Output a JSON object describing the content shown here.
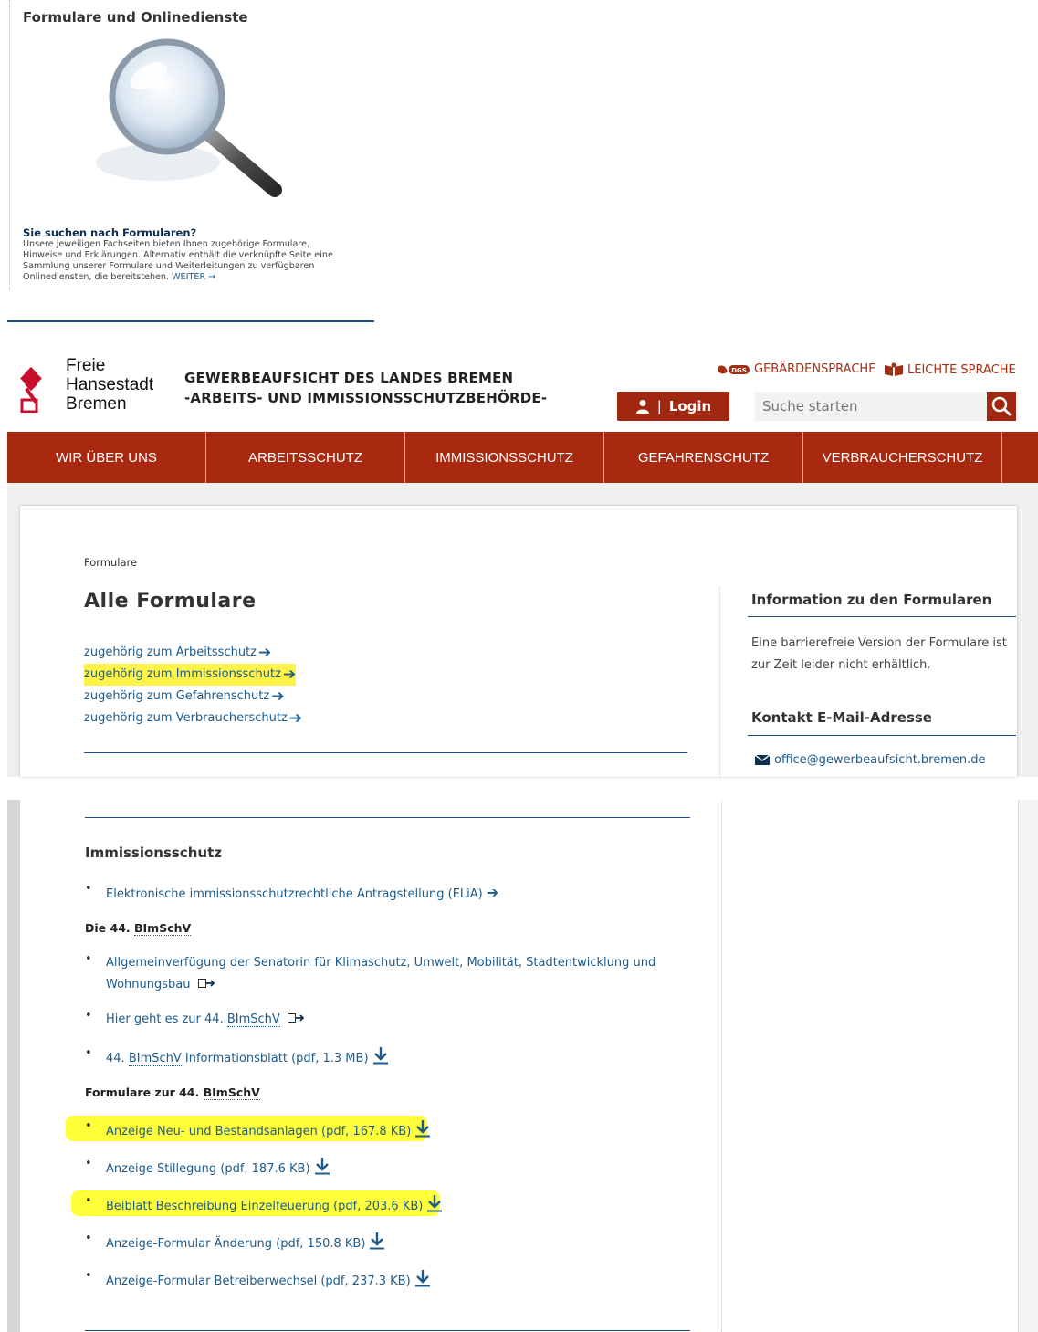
{
  "teaser": {
    "title": "Formulare und Onlinedienste",
    "question": "Sie suchen nach Formularen?",
    "text": "Unsere jeweiligen Fachseiten bieten Ihnen zugehörige Formulare, Hinweise und Erklärungen. Alternativ enthält die verknüpfte Seite eine Sammlung unserer Formulare und Weiterleitungen zu verfügbaren Onlinediensten, die bereitstehen.",
    "more": "WEITER"
  },
  "header": {
    "brand_line1": "Freie",
    "brand_line2": "Hansestadt",
    "brand_line3": "Bremen",
    "agency_line1": "GEWERBEAUFSICHT DES LANDES BREMEN",
    "agency_line2": "-ARBEITS- UND IMMISSIONSSCHUTZBEHÖRDE-",
    "sign_language": "GEBÄRDENSPRACHE",
    "dgs_badge": "DGS",
    "easy_language": "LEICHTE SPRACHE",
    "login": "Login",
    "search_placeholder": "Suche starten"
  },
  "nav": [
    "WIR ÜBER UNS",
    "ARBEITSSCHUTZ",
    "IMMISSIONSSCHUTZ",
    "GEFAHRENSCHUTZ",
    "VERBRAUCHERSCHUTZ"
  ],
  "main": {
    "breadcrumb": "Formulare",
    "title": "Alle Formulare",
    "categories": [
      "zugehörig zum Arbeitsschutz",
      "zugehörig zum Immissionsschutz",
      "zugehörig zum Gefahrenschutz",
      "zugehörig zum Verbraucherschutz"
    ]
  },
  "sidebar": {
    "info_title": "Information zu den Formularen",
    "info_text": "Eine barrierefreie Version der Formulare ist zur Zeit leider nicht erhältlich.",
    "contact_title": "Kontakt E-Mail-Adresse",
    "email": "office@gewerbeaufsicht.bremen.de"
  },
  "lower": {
    "section_title": "Immissionsschutz",
    "elia": "Elektronische immissionsschutzrechtliche Antragstellung (ELiA)",
    "sub1_prefix": "Die 44. ",
    "sub1_abbr": "BImSchV",
    "allg_line1": "Allgemeinverfügung der Senatorin für Klimaschutz, Umwelt, Mobilität, Stadtentwicklung und",
    "allg_line2": "Wohnungsbau",
    "hier_prefix": "Hier geht es zur 44. ",
    "hier_abbr": "BImSchV",
    "info_prefix": "44. ",
    "info_abbr": "BImSchV",
    "info_suffix": " Informationsblatt (pdf, 1.3 MB)",
    "sub2_prefix": "Formulare zur 44. ",
    "sub2_abbr": "BImSchV",
    "downloads": [
      "Anzeige Neu- und Bestandsanlagen (pdf, 167.8 KB)",
      "Anzeige Stillegung (pdf, 187.6 KB)",
      "Beiblatt Beschreibung Einzelfeuerung (pdf, 203.6 KB)",
      "Anzeige-Formular Änderung (pdf, 150.8 KB)",
      "Anzeige-Formular Betreiberwechsel (pdf, 237.3 KB)"
    ],
    "bullet": "•"
  },
  "colors": {
    "brand_red": "#a8290f",
    "link_blue": "#1c5b8c",
    "rule_blue": "#1c4f8a",
    "highlight": "#fff34a"
  }
}
